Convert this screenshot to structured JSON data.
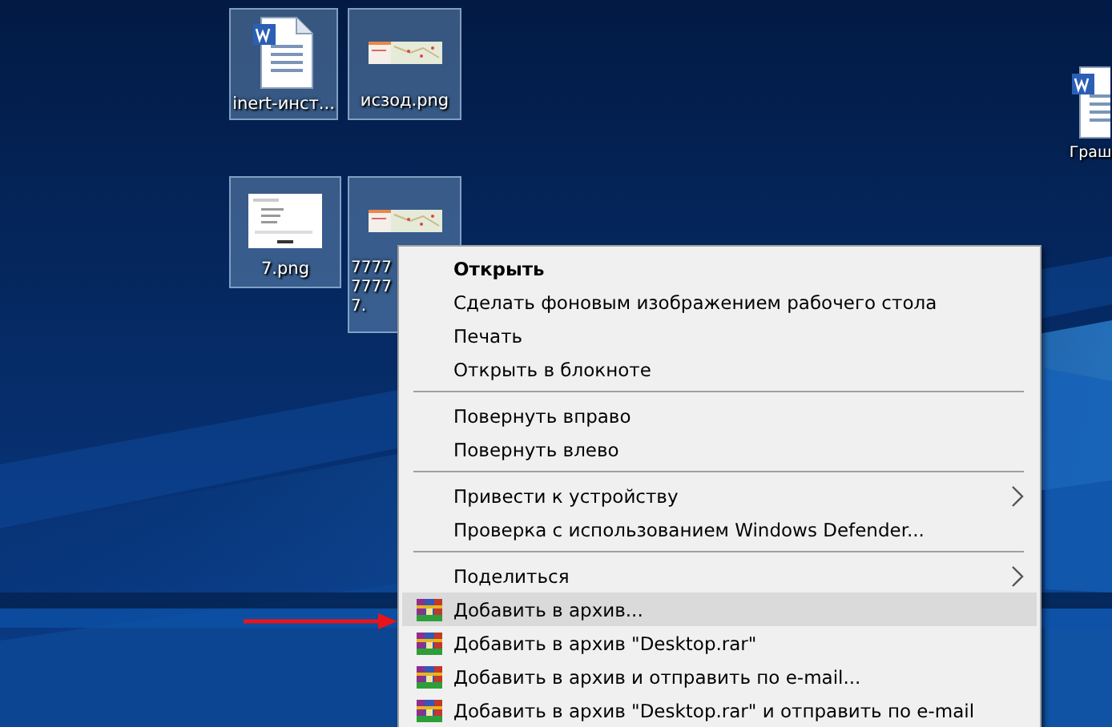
{
  "desktop_icons": [
    {
      "label": "inert-инст...",
      "kind": "document",
      "selected": true
    },
    {
      "label": "исзод.png",
      "kind": "map",
      "selected": true
    },
    {
      "label": "7.png",
      "kind": "screenshot",
      "selected": true
    },
    {
      "label": "7777\n7777\n7.",
      "kind": "map",
      "selected": true
    },
    {
      "label": "Граш",
      "kind": "document",
      "selected": false
    }
  ],
  "context_menu": {
    "items": [
      {
        "kind": "item",
        "label": "Открыть",
        "default": true,
        "submenu": false,
        "selected": false
      },
      {
        "kind": "item",
        "label": "Сделать фоновым изображением рабочего стола",
        "default": false,
        "submenu": false,
        "selected": false
      },
      {
        "kind": "item",
        "label": "Печать",
        "default": false,
        "submenu": false,
        "selected": false
      },
      {
        "kind": "item",
        "label": "Открыть в блокноте",
        "default": false,
        "submenu": false,
        "selected": false
      },
      {
        "kind": "separator"
      },
      {
        "kind": "item",
        "label": "Повернуть вправо",
        "default": false,
        "submenu": false,
        "selected": false
      },
      {
        "kind": "item",
        "label": "Повернуть влево",
        "default": false,
        "submenu": false,
        "selected": false
      },
      {
        "kind": "separator"
      },
      {
        "kind": "item",
        "label": "Привести к устройству",
        "default": false,
        "submenu": true,
        "selected": false
      },
      {
        "kind": "item",
        "label": "Проверка с использованием Windows Defender...",
        "default": false,
        "submenu": false,
        "selected": false
      },
      {
        "kind": "separator"
      },
      {
        "kind": "item",
        "label": "Поделиться",
        "default": false,
        "submenu": true,
        "selected": false
      },
      {
        "kind": "archive",
        "label": "Добавить в архив...",
        "default": false,
        "submenu": false,
        "selected": true
      },
      {
        "kind": "archive",
        "label": "Добавить в архив \"Desktop.rar\"",
        "default": false,
        "submenu": false,
        "selected": false
      },
      {
        "kind": "archive",
        "label": "Добавить в архив и отправить по e-mail...",
        "default": false,
        "submenu": false,
        "selected": false
      },
      {
        "kind": "archive",
        "label": "Добавить в архив \"Desktop.rar\" и отправить по e-mail",
        "default": false,
        "submenu": false,
        "selected": false
      }
    ]
  }
}
